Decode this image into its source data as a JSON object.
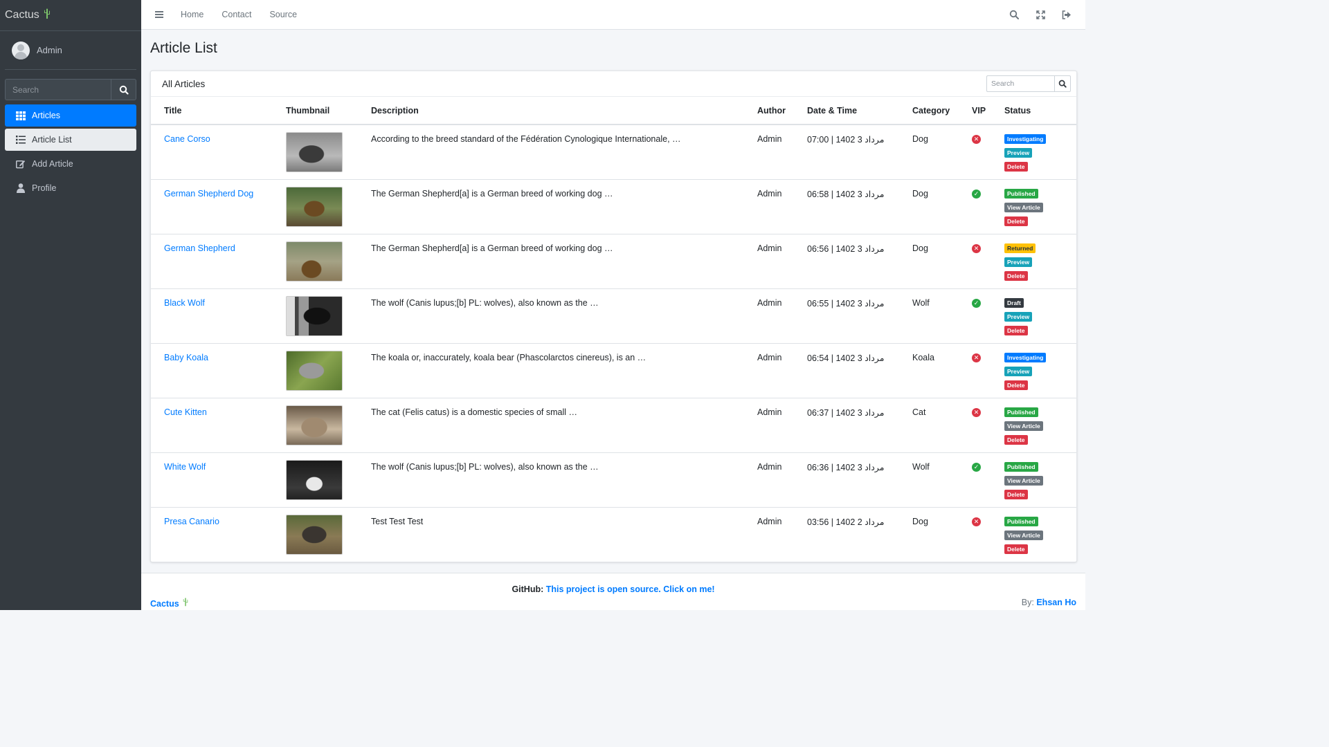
{
  "brand": {
    "name": "Cactus"
  },
  "sidebar": {
    "user": "Admin",
    "search_placeholder": "Search",
    "items": [
      {
        "label": "Articles"
      },
      {
        "label": "Article List"
      },
      {
        "label": "Add Article"
      },
      {
        "label": "Profile"
      }
    ]
  },
  "topbar": {
    "links": [
      {
        "label": "Home"
      },
      {
        "label": "Contact"
      },
      {
        "label": "Source"
      }
    ]
  },
  "page": {
    "title": "Article List"
  },
  "card": {
    "title": "All Articles",
    "search_placeholder": "Search"
  },
  "table": {
    "headers": [
      "Title",
      "Thumbnail",
      "Description",
      "Author",
      "Date & Time",
      "Category",
      "VIP",
      "Status"
    ],
    "rows": [
      {
        "title": "Cane Corso",
        "description": "According to the breed standard of the Fédération Cynologique Internationale, …",
        "author": "Admin",
        "datetime": "07:00 | 1402 مرداد 3",
        "category": "Dog",
        "vip": false,
        "status": "Investigating",
        "action": "Preview",
        "delete": "Delete"
      },
      {
        "title": "German Shepherd Dog",
        "description": "The German Shepherd[a] is a German breed of working dog …",
        "author": "Admin",
        "datetime": "06:58 | 1402 مرداد 3",
        "category": "Dog",
        "vip": true,
        "status": "Published",
        "action": "View Article",
        "delete": "Delete"
      },
      {
        "title": "German Shepherd",
        "description": "The German Shepherd[a] is a German breed of working dog …",
        "author": "Admin",
        "datetime": "06:56 | 1402 مرداد 3",
        "category": "Dog",
        "vip": false,
        "status": "Returned",
        "action": "Preview",
        "delete": "Delete"
      },
      {
        "title": "Black Wolf",
        "description": "The wolf (Canis lupus;[b] PL: wolves), also known as the …",
        "author": "Admin",
        "datetime": "06:55 | 1402 مرداد 3",
        "category": "Wolf",
        "vip": true,
        "status": "Draft",
        "action": "Preview",
        "delete": "Delete"
      },
      {
        "title": "Baby Koala",
        "description": "The koala or, inaccurately, koala bear (Phascolarctos cinereus), is an …",
        "author": "Admin",
        "datetime": "06:54 | 1402 مرداد 3",
        "category": "Koala",
        "vip": false,
        "status": "Investigating",
        "action": "Preview",
        "delete": "Delete"
      },
      {
        "title": "Cute Kitten",
        "description": "The cat (Felis catus) is a domestic species of small …",
        "author": "Admin",
        "datetime": "06:37 | 1402 مرداد 3",
        "category": "Cat",
        "vip": false,
        "status": "Published",
        "action": "View Article",
        "delete": "Delete"
      },
      {
        "title": "White Wolf",
        "description": "The wolf (Canis lupus;[b] PL: wolves), also known as the …",
        "author": "Admin",
        "datetime": "06:36 | 1402 مرداد 3",
        "category": "Wolf",
        "vip": true,
        "status": "Published",
        "action": "View Article",
        "delete": "Delete"
      },
      {
        "title": "Presa Canario",
        "description": "Test Test Test",
        "author": "Admin",
        "datetime": "03:56 | 1402 مرداد 2",
        "category": "Dog",
        "vip": false,
        "status": "Published",
        "action": "View Article",
        "delete": "Delete"
      }
    ]
  },
  "footer": {
    "github_label": "GitHub:",
    "github_link": "This project is open source. Click on me!",
    "brand": "Cactus",
    "by_label": "By:",
    "by_name": "Ehsan Ho"
  },
  "colors": {
    "accent": "#007bff",
    "sidebar_bg": "#343a40",
    "danger": "#dc3545",
    "success": "#28a745",
    "info": "#17a2b8",
    "warning": "#ffc107"
  }
}
